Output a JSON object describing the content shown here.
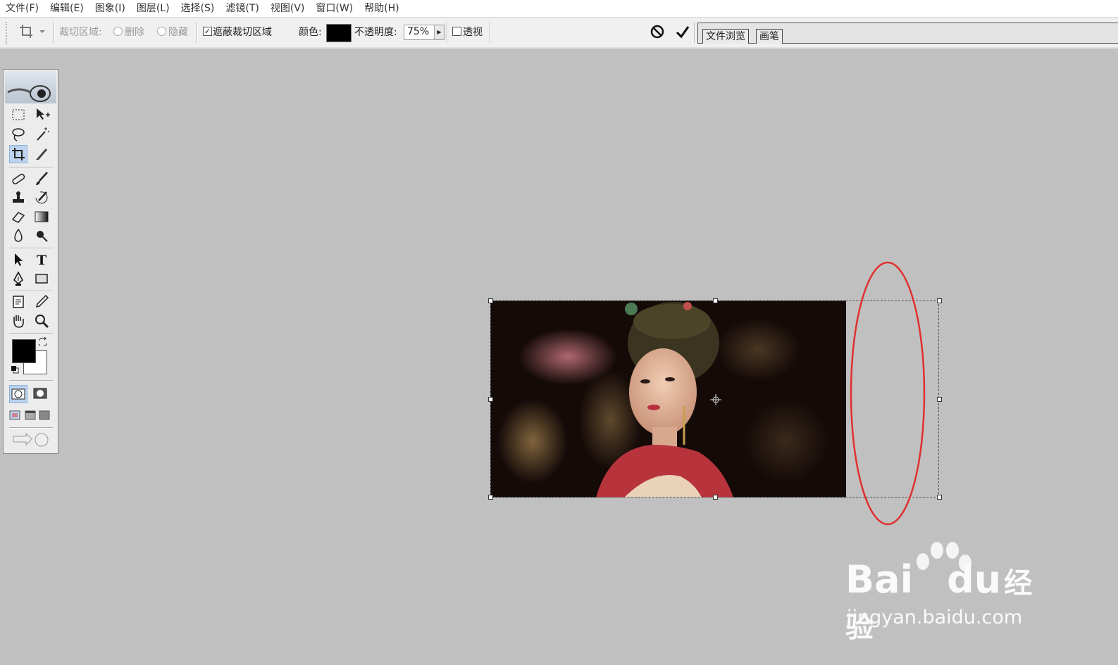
{
  "menu": [
    "文件(F)",
    "编辑(E)",
    "图象(I)",
    "图层(L)",
    "选择(S)",
    "滤镜(T)",
    "视图(V)",
    "窗口(W)",
    "帮助(H)"
  ],
  "options": {
    "crop_area_label": "裁切区域:",
    "delete_label": "删除",
    "hide_label": "隐藏",
    "shield_label": "遮蔽裁切区域",
    "shield_checked": true,
    "color_label": "颜色:",
    "shield_color": "#000000",
    "opacity_label": "不透明度:",
    "opacity_value": "75%",
    "perspective_label": "透视",
    "perspective_checked": false
  },
  "palette_tabs": [
    "文件浏览",
    "画笔"
  ],
  "watermark": {
    "brand": "Bai",
    "brand2": "du",
    "brand_cn": "经验",
    "url": "jingyan.baidu.com"
  },
  "colors": {
    "foreground": "#000000",
    "background": "#ffffff",
    "annotation": "#e03030",
    "canvas_bg": "#c0c0c0"
  }
}
